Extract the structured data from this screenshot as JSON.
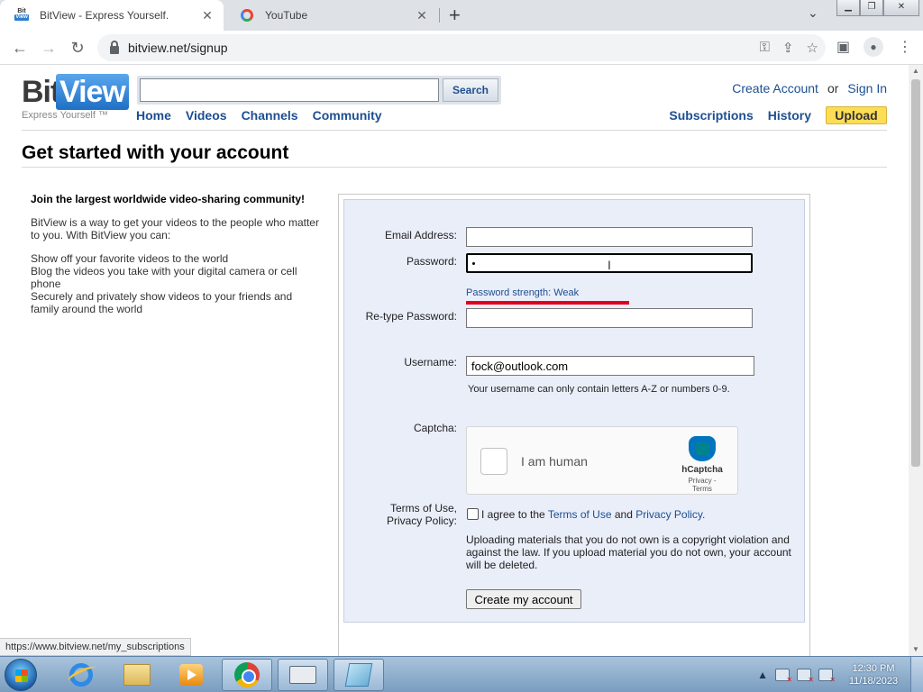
{
  "browser": {
    "tabs": [
      {
        "title": "BitView - Express Yourself.",
        "favicon_text_top": "Bit",
        "favicon_text_bottom": "View"
      },
      {
        "title": "YouTube"
      }
    ],
    "url": "bitview.net/signup",
    "status_url": "https://www.bitview.net/my_subscriptions"
  },
  "site": {
    "logo_bit": "Bit",
    "logo_view": "View",
    "tagline": "Express Yourself ™",
    "search_button": "Search",
    "search_value": "",
    "nav": [
      "Home",
      "Videos",
      "Channels",
      "Community"
    ],
    "create_account": "Create Account",
    "or": "or",
    "sign_in": "Sign In",
    "subscriptions": "Subscriptions",
    "history": "History",
    "upload": "Upload"
  },
  "page": {
    "title": "Get started with your account",
    "intro_heading": "Join the largest worldwide video-sharing community!",
    "intro_text": "BitView is a way to get your videos to the people who matter to you. With BitView you can:",
    "benefits": [
      "Show off your favorite videos to the world",
      "Blog the videos you take with your digital camera or cell phone",
      "Securely and privately show videos to your friends and family around the world"
    ]
  },
  "form": {
    "email_label": "Email Address:",
    "email_value": "",
    "password_label": "Password:",
    "password_value": "•",
    "strength_text": "Password strength: Weak",
    "retype_label": "Re-type Password:",
    "retype_value": "",
    "username_label": "Username:",
    "username_value": "fock@outlook.com",
    "username_hint": "Your username can only contain letters A-Z or numbers 0-9.",
    "captcha_label": "Captcha:",
    "captcha_text": "I am human",
    "captcha_brand": "hCaptcha",
    "captcha_links": "Privacy - Terms",
    "terms_label_1": "Terms of Use,",
    "terms_label_2": "Privacy Policy:",
    "terms_agree": "I agree to the ",
    "terms_link": "Terms of Use",
    "terms_and": " and ",
    "privacy_link": "Privacy Policy.",
    "legal_text": "Uploading materials that you do not own is a copyright violation and against the law. If you upload material you do not own, your account will be deleted.",
    "submit_label": "Create my account"
  },
  "taskbar": {
    "time": "12:30 PM",
    "date": "11/18/2023"
  },
  "colors": {
    "link_blue": "#1d4f91",
    "upload_yellow": "#fddd54",
    "form_bg": "#e9eef9",
    "annotation_red": "#e0001a"
  }
}
